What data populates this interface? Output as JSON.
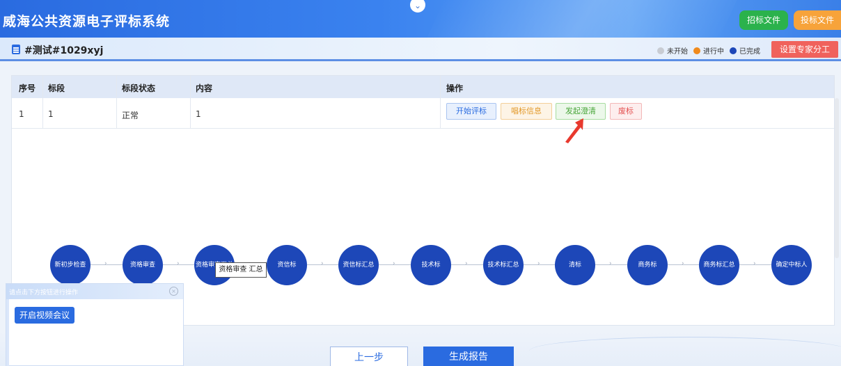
{
  "header": {
    "app_title": "威海公共资源电子评标系统",
    "collapse_icon": "chevron-down-icon",
    "tender_file_label": "招标文件",
    "bid_file_label": "投标文件",
    "colors": {
      "tender": "#2bb24c",
      "bid": "#f7a33a"
    }
  },
  "subheader": {
    "project_name": "#测试#1029xyj",
    "legend": [
      {
        "label": "未开始",
        "color": "#c8ccd3"
      },
      {
        "label": "进行中",
        "color": "#f08a1c"
      },
      {
        "label": "已完成",
        "color": "#1d47b8"
      }
    ],
    "assign_expert_label": "设置专家分工"
  },
  "table": {
    "headers": {
      "seq": "序号",
      "section": "标段",
      "status": "标段状态",
      "content": "内容",
      "ops": "操作"
    },
    "rows": [
      {
        "seq": "1",
        "section": "1",
        "status": "正常",
        "content": "1"
      }
    ],
    "actions": {
      "start_eval": "开始评标",
      "sing_info": "唱标信息",
      "clarify": "发起澄清",
      "abolish": "废标"
    }
  },
  "flow": {
    "nodes": [
      "新初步检查",
      "资格审查",
      "资格审查汇总",
      "资信标",
      "资信标汇总",
      "技术标",
      "技术标汇总",
      "清标",
      "商务标",
      "商务标汇总",
      "确定中标人"
    ],
    "node_color": "#1d47b8",
    "tooltip": "资格审查 汇总"
  },
  "float_panel": {
    "hint": "请点击下方按钮进行操作",
    "video_button": "开启视频会议"
  },
  "footer": {
    "prev_label": "上一步",
    "report_label": "生成报告"
  }
}
